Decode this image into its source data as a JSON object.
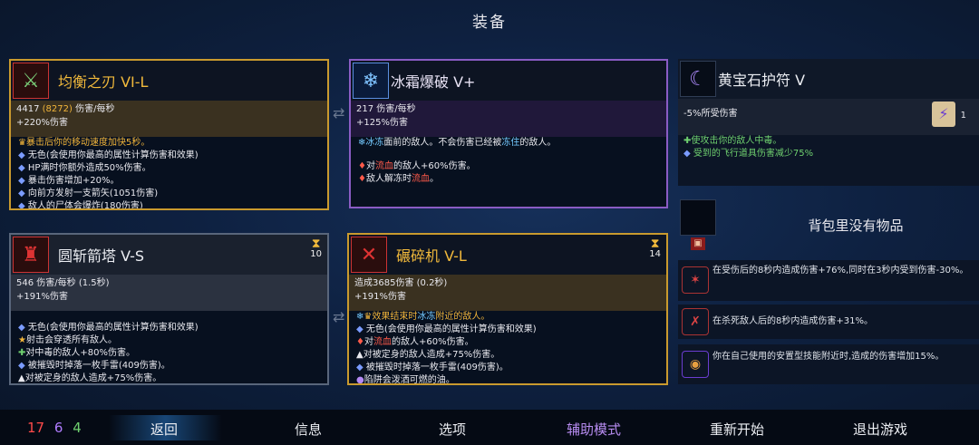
{
  "screen_title": "装备",
  "weapon1": {
    "name": "均衡之刃 VI-L",
    "stat1_dmg": "4417",
    "stat1_paren": "(8272)",
    "stat1_unit": "伤害/每秒",
    "stat2": "+220%伤害",
    "lines": [
      "暴击后你的移动速度加快5秒。",
      "无色(会使用你最高的属性计算伤害和效果)",
      "HP满时你额外造成50%伤害。",
      "暴击伤害增加+20%。",
      "向前方发射一支箭矢(1051伤害)",
      "敌人的尸体会爆炸(180伤害)"
    ]
  },
  "weapon2": {
    "name": "冰霜爆破 V+",
    "stat1": "217 伤害/每秒",
    "stat2": "+125%伤害",
    "line1_a": "冰冻",
    "line1_b": "面前的敌人。不会伤害已经被",
    "line1_c": "冻住",
    "line1_d": "的敌人。",
    "line2_a": "对",
    "line2_b": "流血",
    "line2_c": "的敌人+60%伤害。",
    "line3_a": "敌人解冻时",
    "line3_b": "流血",
    "line3_c": "。"
  },
  "amulet": {
    "name": "黄宝石护符 V",
    "stat": "-5%所受伤害",
    "scroll_count": "1",
    "line1": "使攻击你的敌人中毒。",
    "line2": "受到的飞行道具伤害减少75%"
  },
  "skill1": {
    "name": "圆斩箭塔 V-S",
    "timer": "10",
    "stat1": "546 伤害/每秒 (1.5秒)",
    "stat2": "+191%伤害",
    "lines": [
      "无色(会使用你最高的属性计算伤害和效果)",
      "射击会穿透所有敌人。",
      "对中毒的敌人+80%伤害。",
      "被摧毁时掉落一枚手雷(409伤害)。",
      "对被定身的敌人造成+75%伤害。"
    ]
  },
  "skill2": {
    "name": "碾碎机 V-L",
    "timer": "14",
    "stat1": "造成3685伤害 (0.2秒)",
    "stat2": "+191%伤害",
    "line1_a": "效果结束时",
    "line1_b": "冰冻",
    "line1_c": "附近的敌人。",
    "line2": "无色(会使用你最高的属性计算伤害和效果)",
    "line3_a": "对",
    "line3_b": "流血",
    "line3_c": "的敌人+60%伤害。",
    "line4": "对被定身的敌人造成+75%伤害。",
    "line5": "被摧毁时掉落一枚手雷(409伤害)。",
    "line6": "陷阱会泼洒可燃的油。"
  },
  "backpack": {
    "label": "背包里没有物品"
  },
  "mutations": [
    {
      "text": "在受伤后的8秒内造成伤害+76%,同时在3秒内受到伤害-30%。"
    },
    {
      "text": "在杀死敌人后的8秒内造成伤害+31%。"
    },
    {
      "text": "你在自己使用的安置型技能附近时,造成的伤害增加15%。"
    }
  ],
  "scrolls": {
    "brutality": "17",
    "tactics": "6",
    "survival": "4"
  },
  "menu": {
    "back": "返回",
    "info": "信息",
    "options": "选项",
    "assist": "辅助模式",
    "restart": "重新开始",
    "quit": "退出游戏"
  },
  "colors": {
    "brutality": "#ff4a4a",
    "tactics": "#b07cff",
    "survival": "#6fd06f",
    "gold_frame": "#c99a2e",
    "purple_frame": "#8a5cc4",
    "assist_menu": "#b78cf0"
  }
}
